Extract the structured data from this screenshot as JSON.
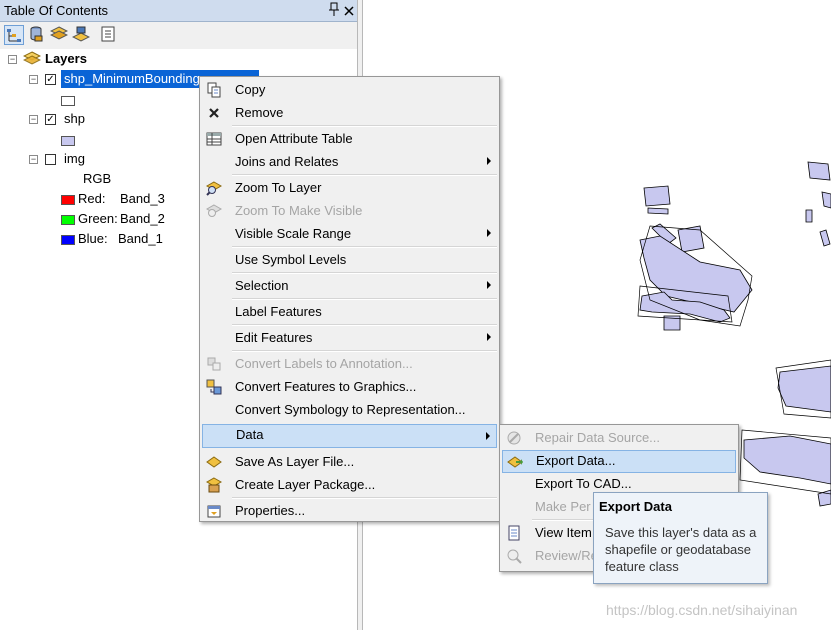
{
  "toc": {
    "title": "Table Of Contents",
    "pin_icon": "pin-icon",
    "close_icon": "close-icon",
    "toolbar": [
      "list-by-drawing-order-icon",
      "list-by-source-icon",
      "list-by-visibility-icon",
      "list-by-selection-icon",
      "options-icon"
    ],
    "root": "Layers",
    "layers": [
      {
        "name": "shp_MinimumBounding",
        "checked": true,
        "selected": true
      },
      {
        "name": "shp",
        "checked": true
      },
      {
        "name": "img",
        "checked": false
      }
    ],
    "img_legend": {
      "header": "RGB",
      "bands": [
        {
          "label": "Red:",
          "band": "Band_3",
          "color": "#ff0000"
        },
        {
          "label": "Green:",
          "band": "Band_2",
          "color": "#00ff00"
        },
        {
          "label": "Blue:",
          "band": "Band_1",
          "color": "#0000ff"
        }
      ]
    },
    "shp_symbol_color": "#c8c8ef"
  },
  "context_menu": {
    "items": [
      {
        "label": "Copy",
        "icon": "copy-icon"
      },
      {
        "label": "Remove",
        "icon": "remove-x-icon"
      },
      {
        "label": "Open Attribute Table",
        "icon": "table-icon"
      },
      {
        "label": "Joins and Relates",
        "submenu": true
      },
      {
        "label": "Zoom To Layer",
        "icon": "zoom-to-layer-icon"
      },
      {
        "label": "Zoom To Make Visible",
        "icon": "zoom-visible-icon",
        "disabled": true
      },
      {
        "label": "Visible Scale Range",
        "submenu": true
      },
      {
        "label": "Use Symbol Levels"
      },
      {
        "label": "Selection",
        "submenu": true
      },
      {
        "label": "Label Features"
      },
      {
        "label": "Edit Features",
        "submenu": true
      },
      {
        "label": "Convert Labels to Annotation...",
        "icon": "convert-labels-icon",
        "disabled": true
      },
      {
        "label": "Convert Features to Graphics...",
        "icon": "convert-graphics-icon"
      },
      {
        "label": "Convert Symbology to Representation..."
      },
      {
        "label": "Data",
        "submenu": true,
        "highlighted": true
      },
      {
        "label": "Save As Layer File...",
        "icon": "layer-file-icon"
      },
      {
        "label": "Create Layer Package...",
        "icon": "layer-package-icon"
      },
      {
        "label": "Properties...",
        "icon": "properties-icon"
      }
    ]
  },
  "data_submenu": {
    "items": [
      {
        "label": "Repair Data Source...",
        "icon": "repair-icon",
        "disabled": true
      },
      {
        "label": "Export Data...",
        "icon": "export-data-icon",
        "highlighted": true
      },
      {
        "label": "Export To CAD..."
      },
      {
        "label": "Make Per",
        "disabled": true
      },
      {
        "label": "View Item",
        "icon": "view-item-icon"
      },
      {
        "label": "Review/Re",
        "icon": "review-icon",
        "disabled": true
      }
    ]
  },
  "tooltip": {
    "title": "Export Data",
    "text": "Save this layer's data as a shapefile or geodatabase feature class"
  },
  "watermark": "https://blog.csdn.net/sihaiyinan",
  "map": {
    "polygon_fill": "#c8c8ef",
    "outline": "#000000"
  }
}
